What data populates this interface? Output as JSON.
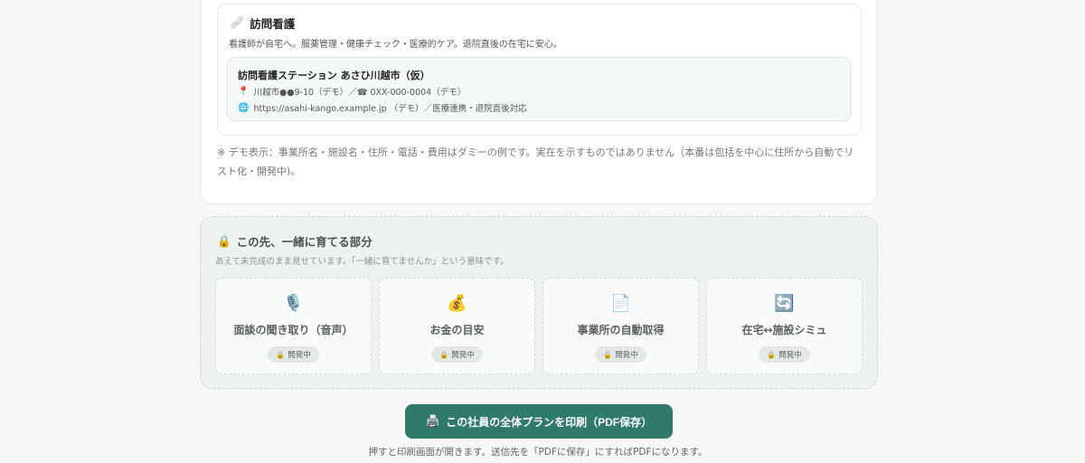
{
  "service": {
    "icon": "🩹",
    "title": "訪問看護",
    "description": "看護師が自宅へ。服薬管理・健康チェック・医療的ケア。退院直後の在宅に安心。",
    "facility": {
      "name": "訪問看護ステーション あさひ川越市（仮）",
      "pin_icon": "📍",
      "address": "川越市●●9-10（デモ）／☎ 0XX-000-0004（デモ）",
      "globe_icon": "🌐",
      "url_line": "https://asahi-kango.example.jp （デモ）／医療連携・退院直後対応"
    }
  },
  "demo_note": "※ デモ表示：事業所名・施設名・住所・電話・費用はダミーの例です。実在を示すものではありません（本番は包括を中心に住所から自動でリスト化・開発中)。",
  "future": {
    "lock_icon": "🔒",
    "title": "この先、一緒に育てる部分",
    "subtitle": "あえて未完成のまま見せています。「一緒に育てませんか」という意味です。",
    "features": [
      {
        "icon": "🎙️",
        "label": "面談の聞き取り（音声）",
        "badge": "開発中"
      },
      {
        "icon": "💰",
        "label": "お金の目安",
        "badge": "開発中"
      },
      {
        "icon": "📄",
        "label": "事業所の自動取得",
        "badge": "開発中"
      },
      {
        "icon": "🔄",
        "label": "在宅↔施設シミュ",
        "badge": "開発中"
      }
    ],
    "badge_lock": "🔒"
  },
  "print": {
    "icon": "🖨️",
    "label": "この社員の全体プランを印刷（PDF保存）",
    "hint": "押すと印刷画面が開きます。送信先を「PDFに保存」にすればPDFになります。"
  },
  "colors": {
    "primary_button": "#2f7a6a",
    "page_background": "#f6f7f6"
  }
}
